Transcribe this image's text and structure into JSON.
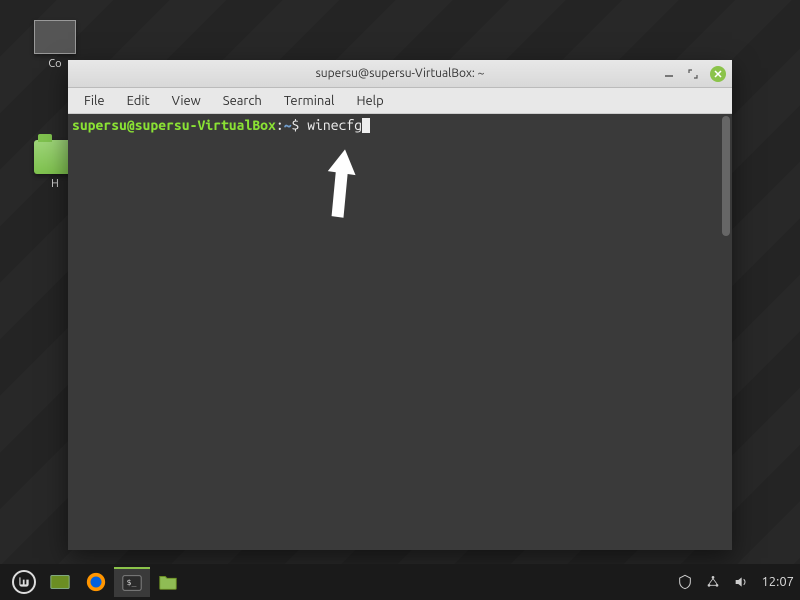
{
  "desktop": {
    "icons": [
      {
        "label": "Co"
      },
      {
        "label": "H"
      }
    ]
  },
  "terminal": {
    "title": "supersu@supersu-VirtualBox: ~",
    "menubar": [
      "File",
      "Edit",
      "View",
      "Search",
      "Terminal",
      "Help"
    ],
    "prompt": {
      "user_host": "supersu@supersu-VirtualBox",
      "separator": ":",
      "path": "~",
      "symbol": "$",
      "command": "winecfg"
    }
  },
  "taskbar": {
    "clock": "12:07"
  }
}
